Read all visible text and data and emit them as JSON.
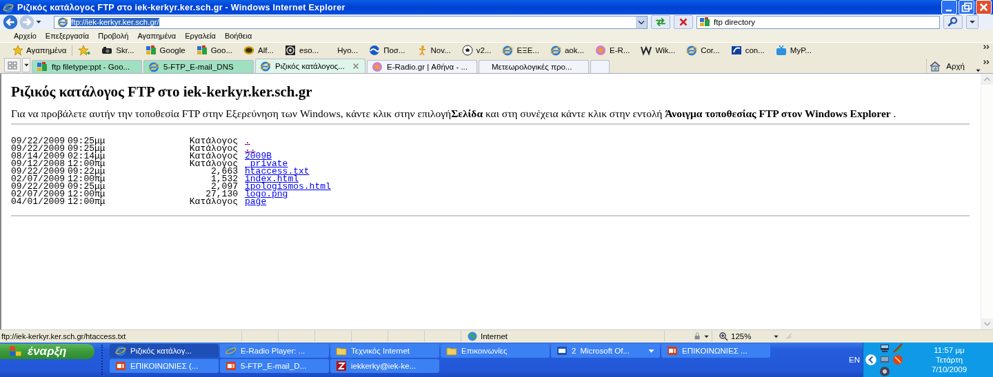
{
  "window": {
    "title": "Ριζικός κατάλογος FTP στο iek-kerkyr.ker.sch.gr - Windows Internet Explorer"
  },
  "address_bar": {
    "value": "ftp://iek-kerkyr.ker.sch.gr/"
  },
  "search": {
    "value": "ftp directory"
  },
  "menu": [
    "Αρχείο",
    "Επεξεργασία",
    "Προβολή",
    "Αγαπημένα",
    "Εργαλεία",
    "Βοήθεια"
  ],
  "favorites_button": "Αγαπημένα",
  "favorites": [
    {
      "label": "Skr...",
      "kind": "camera"
    },
    {
      "label": "Google",
      "kind": "google"
    },
    {
      "label": "Goo...",
      "kind": "google"
    },
    {
      "label": "Alf...",
      "kind": "badge"
    },
    {
      "label": "eso...",
      "kind": "disc"
    },
    {
      "label": "Hyo...",
      "kind": "plain"
    },
    {
      "label": "Ποσ...",
      "kind": "wave"
    },
    {
      "label": "Nov...",
      "kind": "figure"
    },
    {
      "label": "v2...",
      "kind": "ball"
    },
    {
      "label": "ΕΞΕ...",
      "kind": "ie"
    },
    {
      "label": "aok...",
      "kind": "ie"
    },
    {
      "label": "E-R...",
      "kind": "flower"
    },
    {
      "label": "Wik...",
      "kind": "wiki"
    },
    {
      "label": "Cor...",
      "kind": "ie"
    },
    {
      "label": "con...",
      "kind": "swoosh"
    },
    {
      "label": "MyP...",
      "kind": "tv"
    }
  ],
  "tabs": [
    {
      "label": "ftp filetype:ppt - Goo...",
      "kind": "google",
      "grouped": true,
      "selected": false
    },
    {
      "label": "5-FTP_E-mail_DNS",
      "kind": "ie",
      "grouped": true,
      "selected": false
    },
    {
      "label": "Ριζικός κατάλογος...",
      "kind": "ie",
      "grouped": true,
      "selected": true
    },
    {
      "label": "E-Radio.gr | Αθήνα - ...",
      "kind": "flower",
      "grouped": false,
      "selected": false
    },
    {
      "label": "Μετεωρολογικές προ...",
      "kind": "plain",
      "grouped": false,
      "selected": false
    }
  ],
  "home_button": "Αρχή",
  "page": {
    "heading": "Ριζικός κατάλογος FTP στο iek-kerkyr.ker.sch.gr",
    "intro": "Για να προβάλετε αυτήν την τοποθεσία FTP στην Εξερεύνηση των Windows, κάντε κλικ στην επιλογή**Σελίδα** και στη συνέχεια κάντε κλικ στην εντολή **Άνοιγμα τοποθεσίας FTP στον Windows Explorer** .",
    "listing": [
      {
        "date": "09/22/2009",
        "time": "09:25μμ",
        "size": "Κατάλογος",
        "name": ".",
        "visited": true
      },
      {
        "date": "09/22/2009",
        "time": "09:25μμ",
        "size": "Κατάλογος",
        "name": "..",
        "visited": true
      },
      {
        "date": "08/14/2009",
        "time": "02:14μμ",
        "size": "Κατάλογος",
        "name": "2009B",
        "visited": false
      },
      {
        "date": "09/12/2008",
        "time": "12:00πμ",
        "size": "Κατάλογος",
        "name": "_private",
        "visited": false
      },
      {
        "date": "09/22/2009",
        "time": "09:22μμ",
        "size": "2,663",
        "name": "htaccess.txt",
        "visited": false
      },
      {
        "date": "02/07/2009",
        "time": "12:00πμ",
        "size": "1,532",
        "name": "index.html",
        "visited": false
      },
      {
        "date": "09/22/2009",
        "time": "09:25μμ",
        "size": "2,097",
        "name": "ipologismos.html",
        "visited": false
      },
      {
        "date": "02/07/2009",
        "time": "12:00πμ",
        "size": "27,130",
        "name": "logo.png",
        "visited": false
      },
      {
        "date": "04/01/2009",
        "time": "12:00πμ",
        "size": "Κατάλογος",
        "name": "page",
        "visited": false
      }
    ]
  },
  "status_bar": {
    "url": "ftp://iek-kerkyr.ker.sch.gr/htaccess.txt",
    "zone": "Internet",
    "zoom": "125%"
  },
  "taskbar": {
    "start": "έναρξη",
    "buttons": [
      {
        "label": "Ριζικός κατάλογ...",
        "kind": "ie",
        "selected": true
      },
      {
        "label": "E-Radio Player: ...",
        "kind": "ie",
        "selected": false
      },
      {
        "label": "Τεχνικός Internet",
        "kind": "folder",
        "selected": false
      },
      {
        "label": "Επικοινωνίες",
        "kind": "folder",
        "selected": false
      },
      {
        "label": "Microsoft Of...",
        "count": "2",
        "kind": "word",
        "selected": false
      },
      {
        "label": "ΕΠΙΚΟΙΝΩΝΙΕΣ ...",
        "kind": "ppt",
        "selected": false
      },
      {
        "label": "ΕΠΙΚΟΙΝΩΝΙΕΣ (...",
        "kind": "ppt",
        "selected": false
      },
      {
        "label": "5-FTP_E-mail_D...",
        "kind": "ppt",
        "selected": false
      },
      {
        "label": "iekkerky@iek-ke...",
        "kind": "fz",
        "selected": false
      }
    ],
    "language": "EN",
    "time": "11:57 μμ",
    "day": "Τετάρτη",
    "date": "7/10/2009"
  }
}
